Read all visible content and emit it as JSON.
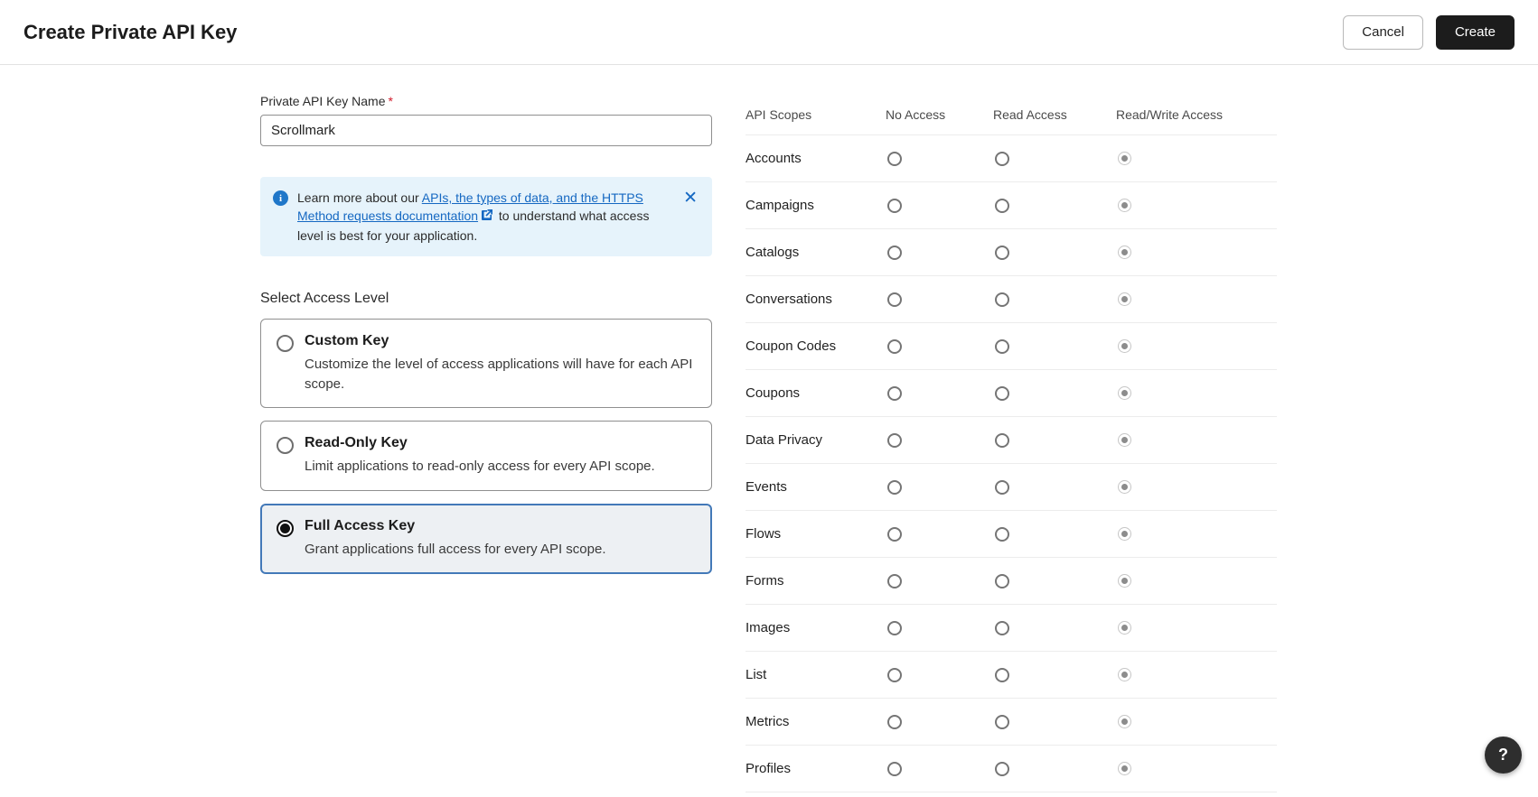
{
  "header": {
    "title": "Create Private API Key",
    "cancel_label": "Cancel",
    "create_label": "Create"
  },
  "form": {
    "name_label": "Private API Key Name",
    "required_marker": "*",
    "name_value": "Scrollmark",
    "info_alert": {
      "text_before": "Learn more about our ",
      "link_text": "APIs, the types of data, and the HTTPS Method requests documentation",
      "text_after": " to understand what access level is best for your application.",
      "close_label": "✕"
    },
    "access_level_label": "Select Access Level",
    "options": [
      {
        "title": "Custom Key",
        "description": "Customize the level of access applications will have for each API scope.",
        "selected": false
      },
      {
        "title": "Read-Only Key",
        "description": "Limit applications to read-only access for every API scope.",
        "selected": false
      },
      {
        "title": "Full Access Key",
        "description": "Grant applications full access for every API scope.",
        "selected": true
      }
    ]
  },
  "scopes_table": {
    "headers": [
      "API Scopes",
      "No Access",
      "Read Access",
      "Read/Write Access"
    ],
    "rows": [
      "Accounts",
      "Campaigns",
      "Catalogs",
      "Conversations",
      "Coupon Codes",
      "Coupons",
      "Data Privacy",
      "Events",
      "Flows",
      "Forms",
      "Images",
      "List",
      "Metrics",
      "Profiles"
    ],
    "selected_column": "Read/Write Access"
  },
  "help_button_label": "?",
  "colors": {
    "accent_blue": "#1568c2",
    "alert_background": "#e6f3fb",
    "selected_card_border": "#4379b8",
    "primary_button": "#1c1c1c"
  }
}
